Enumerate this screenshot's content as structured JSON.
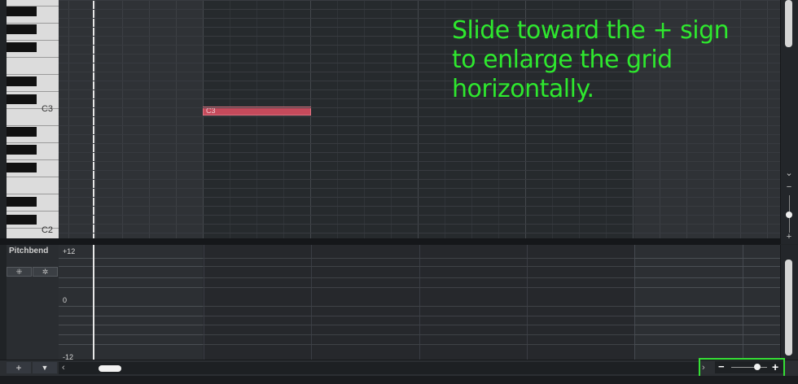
{
  "piano": {
    "label_c3": "C3",
    "label_c2": "C2"
  },
  "note": {
    "label": "C3",
    "color": "#c54a5b"
  },
  "controller_lane": {
    "name": "Pitchbend",
    "btn_left_icon": "⁜",
    "btn_right_icon": "✲",
    "scale_top": "+12",
    "scale_mid": "0",
    "scale_bottom": "-12"
  },
  "bottombar": {
    "add_label": "+",
    "dropdown_label": "▼",
    "scroll_left_label": "‹",
    "scroll_right_label": "›",
    "zoom_minus_label": "−",
    "zoom_plus_label": "+",
    "zoom_level": 0.8
  },
  "vscroll": {
    "up_label": "⌃",
    "down_label": "⌄",
    "zoom_minus": "−",
    "zoom_plus": "+"
  },
  "annotation": {
    "line1": "Slide toward the + sign",
    "line2": "to enlarge the grid",
    "line3": "horizontally.",
    "color": "#2ee82e"
  }
}
